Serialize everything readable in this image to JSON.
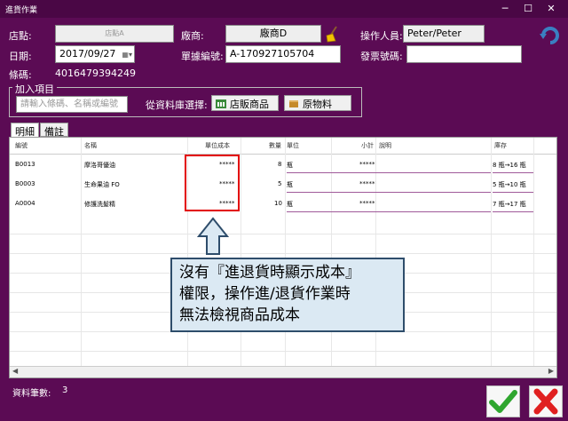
{
  "window": {
    "title": "進貨作業",
    "min": "─",
    "max": "☐",
    "close": "✕"
  },
  "form": {
    "store_label": "店點:",
    "store_value": "店點A",
    "vendor_label": "廠商:",
    "vendor_value": "廠商D",
    "operator_label": "操作人員:",
    "operator_value": "Peter/Peter",
    "date_label": "日期:",
    "date_value": "2017/09/27",
    "doc_no_label": "單據編號:",
    "doc_no_value": "A-170927105704",
    "invoice_label": "發票號碼:",
    "invoice_value": "",
    "barcode_label": "條碼:",
    "barcode_value": "4016479394249"
  },
  "add_items": {
    "legend": "加入項目",
    "search_placeholder": "請輸入條碼、名稱或編號",
    "from_db_label": "從資料庫選擇:",
    "store_goods_btn": "店販商品",
    "raw_material_btn": "原物料"
  },
  "tabs": [
    {
      "label": "明細"
    },
    {
      "label": "備註"
    }
  ],
  "table": {
    "columns": [
      "編號",
      "名稱",
      "單位成本",
      "數量",
      "單位",
      "小計",
      "說明",
      "庫存"
    ],
    "rows": [
      {
        "code": "B0013",
        "name": "摩洛哥優油",
        "unit_cost": "*****",
        "qty": "8",
        "unit": "瓶",
        "subtotal": "*****",
        "note": "",
        "stock": "8 瓶→16 瓶"
      },
      {
        "code": "B0003",
        "name": "生命果油 FO",
        "unit_cost": "*****",
        "qty": "5",
        "unit": "瓶",
        "subtotal": "*****",
        "note": "",
        "stock": "5 瓶→10 瓶"
      },
      {
        "code": "A0004",
        "name": "修護洗髮精",
        "unit_cost": "*****",
        "qty": "10",
        "unit": "瓶",
        "subtotal": "*****",
        "note": "",
        "stock": "7 瓶→17 瓶"
      }
    ]
  },
  "callout": {
    "line1": "沒有『進退貨時顯示成本』",
    "line2": "權限，操作進/退貨作業時",
    "line3": "無法檢視商品成本"
  },
  "footer": {
    "count_label": "資料筆數:",
    "count_value": "3"
  },
  "colors": {
    "bg": "#5b0b54",
    "highlight": "#e20000",
    "callout_bg": "#dbe9f3"
  }
}
